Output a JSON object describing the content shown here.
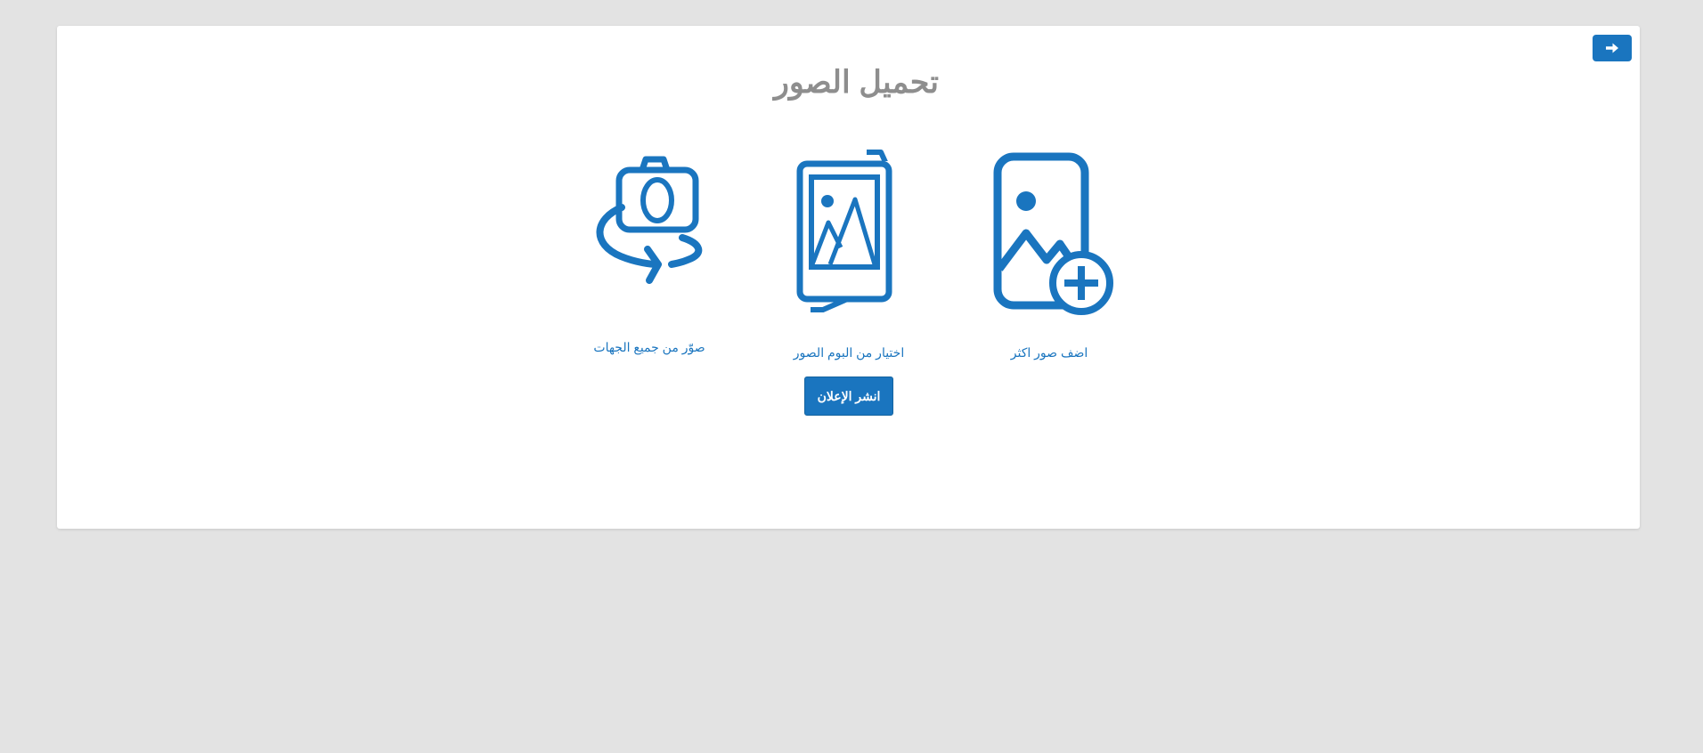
{
  "header": {
    "back_icon": "arrow-right-icon",
    "title": "تحميل الصور"
  },
  "options": [
    {
      "label": "اضف صور اكثر",
      "icon": "add-image-icon"
    },
    {
      "label": "اختيار من البوم الصور",
      "icon": "photo-album-icon"
    },
    {
      "label": "صوّر من جميع الجهات",
      "icon": "rotate-camera-icon"
    }
  ],
  "actions": {
    "publish_label": "انشر الإعلان"
  },
  "colors": {
    "background": "#e3e3e3",
    "card": "#ffffff",
    "accent": "#1a75bf",
    "title": "#8e8e8e"
  }
}
